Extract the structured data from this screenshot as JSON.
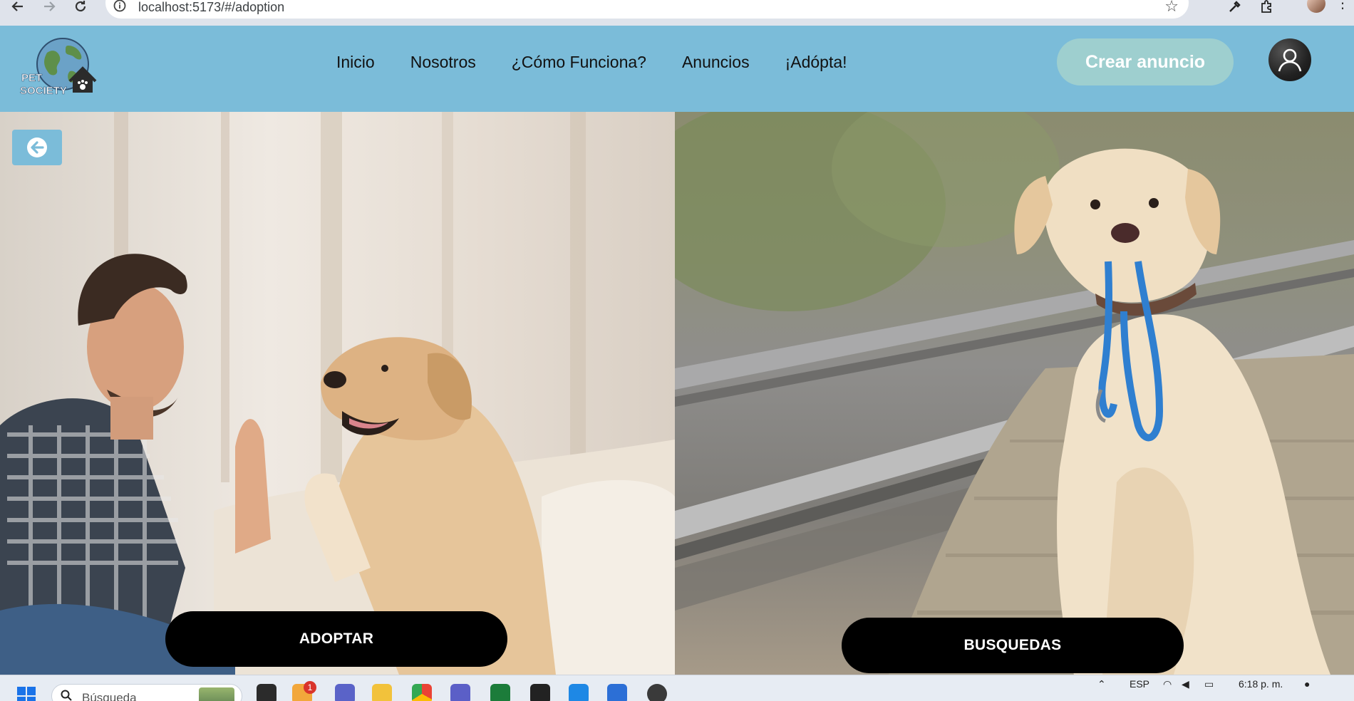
{
  "browser": {
    "url": "localhost:5173/#/adoption"
  },
  "header": {
    "logo_text_line1": "PET",
    "logo_text_line2": "SOCIETY",
    "nav": [
      {
        "label": "Inicio"
      },
      {
        "label": "Nosotros"
      },
      {
        "label": "¿Cómo Funciona?"
      },
      {
        "label": "Anuncios"
      },
      {
        "label": "¡Adópta!"
      }
    ],
    "create_label": "Crear anuncio"
  },
  "main": {
    "adopt_label": "ADOPTAR",
    "search_label": "BUSQUEDAS"
  },
  "taskbar": {
    "search_placeholder": "Búsqueda",
    "notification_count": "1",
    "lang": "ESP",
    "time": "6:18 p. m."
  },
  "colors": {
    "header_bg": "#7bbcd9",
    "create_button_bg": "#9ecfcf",
    "cta_bg": "#000000"
  }
}
